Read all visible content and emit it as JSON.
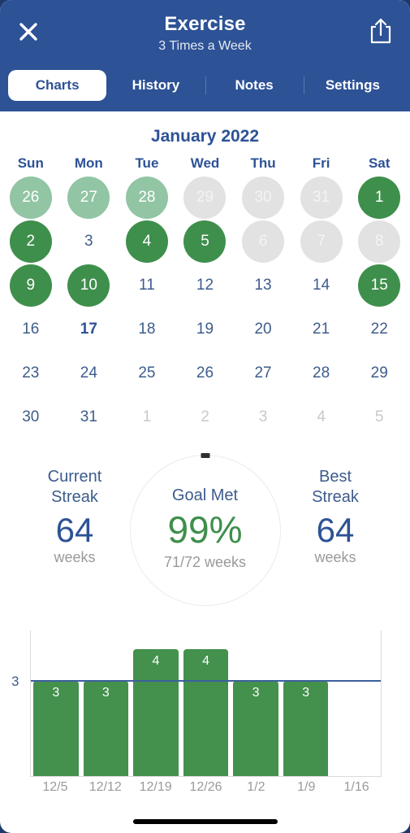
{
  "header": {
    "title": "Exercise",
    "subtitle": "3 Times a Week",
    "close_icon": "close-icon",
    "share_icon": "share-icon",
    "background_color": "#2d5296"
  },
  "tabs": [
    {
      "label": "Charts",
      "active": true
    },
    {
      "label": "History",
      "active": false
    },
    {
      "label": "Notes",
      "active": false
    },
    {
      "label": "Settings",
      "active": false
    }
  ],
  "calendar": {
    "month": "January 2022",
    "dow": [
      "Sun",
      "Mon",
      "Tue",
      "Wed",
      "Thu",
      "Fri",
      "Sat"
    ],
    "days": [
      {
        "n": "26",
        "state": "done-out"
      },
      {
        "n": "27",
        "state": "done-out"
      },
      {
        "n": "28",
        "state": "done-out"
      },
      {
        "n": "29",
        "state": "miss"
      },
      {
        "n": "30",
        "state": "miss"
      },
      {
        "n": "31",
        "state": "miss"
      },
      {
        "n": "1",
        "state": "done"
      },
      {
        "n": "2",
        "state": "done"
      },
      {
        "n": "3",
        "state": "plain"
      },
      {
        "n": "4",
        "state": "done"
      },
      {
        "n": "5",
        "state": "done"
      },
      {
        "n": "6",
        "state": "miss"
      },
      {
        "n": "7",
        "state": "miss"
      },
      {
        "n": "8",
        "state": "miss"
      },
      {
        "n": "9",
        "state": "done"
      },
      {
        "n": "10",
        "state": "done"
      },
      {
        "n": "11",
        "state": "plain"
      },
      {
        "n": "12",
        "state": "plain"
      },
      {
        "n": "13",
        "state": "plain"
      },
      {
        "n": "14",
        "state": "plain"
      },
      {
        "n": "15",
        "state": "done"
      },
      {
        "n": "16",
        "state": "plain"
      },
      {
        "n": "17",
        "state": "today"
      },
      {
        "n": "18",
        "state": "plain"
      },
      {
        "n": "19",
        "state": "plain"
      },
      {
        "n": "20",
        "state": "plain"
      },
      {
        "n": "21",
        "state": "plain"
      },
      {
        "n": "22",
        "state": "plain"
      },
      {
        "n": "23",
        "state": "plain"
      },
      {
        "n": "24",
        "state": "plain"
      },
      {
        "n": "25",
        "state": "plain"
      },
      {
        "n": "26",
        "state": "plain"
      },
      {
        "n": "27",
        "state": "plain"
      },
      {
        "n": "28",
        "state": "plain"
      },
      {
        "n": "29",
        "state": "plain"
      },
      {
        "n": "30",
        "state": "plain"
      },
      {
        "n": "31",
        "state": "plain"
      },
      {
        "n": "1",
        "state": "outside"
      },
      {
        "n": "2",
        "state": "outside"
      },
      {
        "n": "3",
        "state": "outside"
      },
      {
        "n": "4",
        "state": "outside"
      },
      {
        "n": "5",
        "state": "outside"
      }
    ],
    "colors": {
      "done": "#3f8f4c",
      "done_previous_month": "#91c5a4",
      "missed": "#e2e2e2",
      "text_blue": "#3d5c8c"
    }
  },
  "stats": {
    "current_streak": {
      "label_line1": "Current",
      "label_line2": "Streak",
      "value": "64",
      "unit": "weeks"
    },
    "goal_met": {
      "label": "Goal Met",
      "percent": "99%",
      "detail": "71/72 weeks"
    },
    "best_streak": {
      "label_line1": "Best",
      "label_line2": "Streak",
      "value": "64",
      "unit": "weeks"
    }
  },
  "chart_data": {
    "type": "bar",
    "title": "",
    "xlabel": "",
    "ylabel": "",
    "categories": [
      "12/5",
      "12/12",
      "12/19",
      "12/26",
      "1/2",
      "1/9",
      "1/16"
    ],
    "values": [
      3,
      3,
      4,
      4,
      3,
      3,
      0
    ],
    "bar_labels": [
      "3",
      "3",
      "4",
      "4",
      "3",
      "3",
      ""
    ],
    "goal_line": {
      "value": 3,
      "label": "3",
      "color": "#3c5f9e"
    },
    "ylim": [
      0,
      4.6
    ],
    "grid": false,
    "legend": "none",
    "bar_color": "#44904d"
  }
}
